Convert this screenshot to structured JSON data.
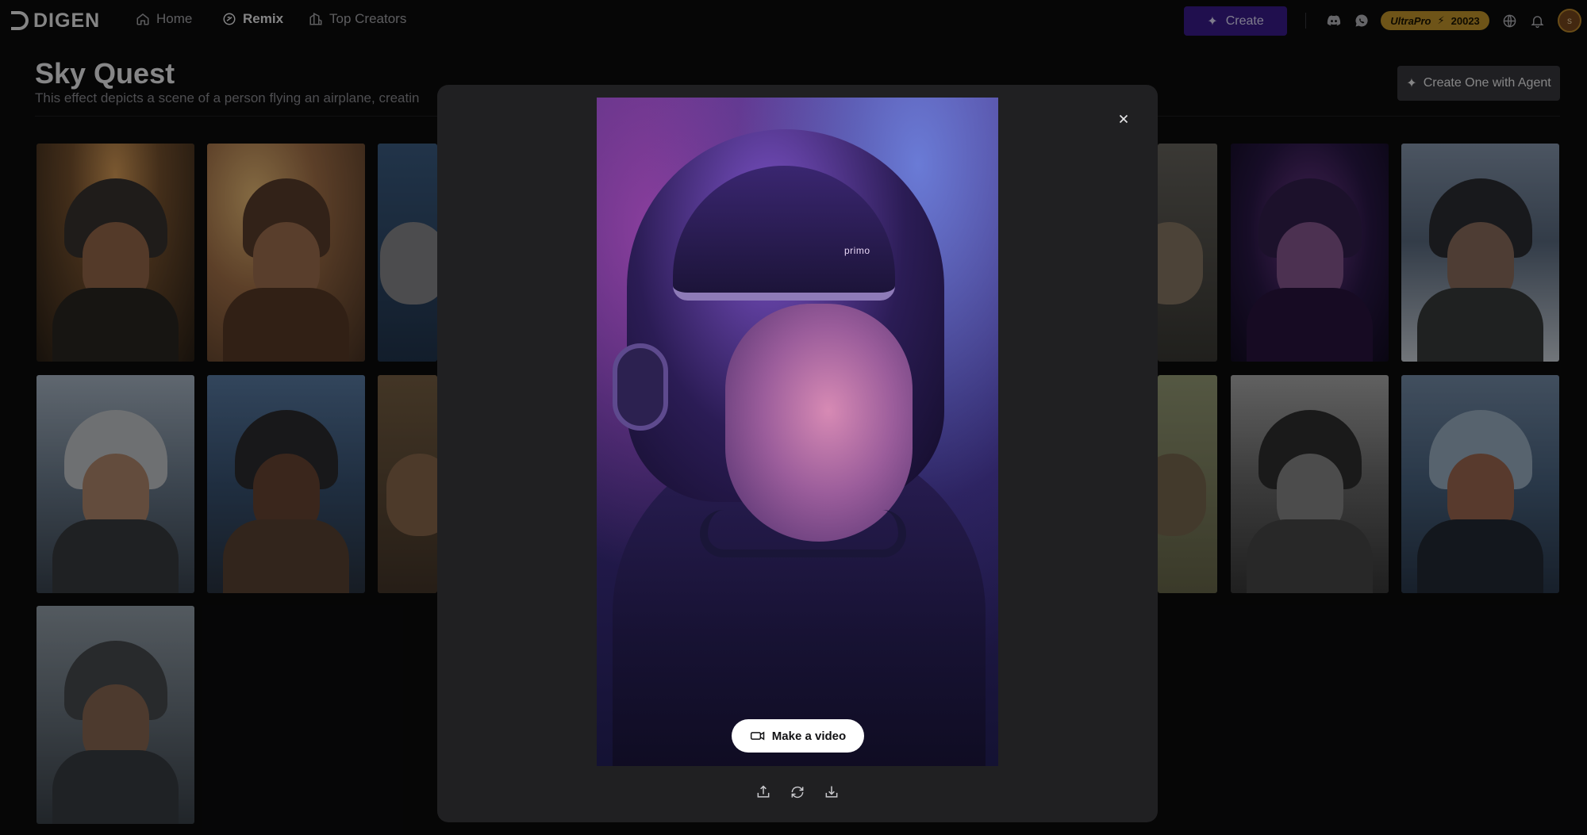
{
  "app": {
    "logo_text": "DIGEN"
  },
  "nav": {
    "items": [
      {
        "label": "Home",
        "icon": "home-icon",
        "active": false
      },
      {
        "label": "Remix",
        "icon": "remix-icon",
        "active": true
      },
      {
        "label": "Top Creators",
        "icon": "buildings-icon",
        "active": false
      }
    ]
  },
  "toolbar": {
    "create_label": "Create",
    "plan_label": "UltraPro",
    "credits": "20023",
    "avatar_initial": "s",
    "icons": [
      "discord-icon",
      "chat-icon",
      "globe-icon",
      "bell-icon"
    ]
  },
  "page": {
    "title": "Sky Quest",
    "description": "This effect depicts a scene of a person flying an airplane, creatin",
    "agent_button_label": "Create One with Agent"
  },
  "modal": {
    "preview_brand": "primo",
    "make_video_label": "Make a video",
    "actions": [
      "share-icon",
      "refresh-icon",
      "download-icon"
    ]
  },
  "colors": {
    "accent": "#3b1d8f",
    "gold": "#c89a2d",
    "background": "#0b0b0c",
    "modal": "#202022"
  }
}
